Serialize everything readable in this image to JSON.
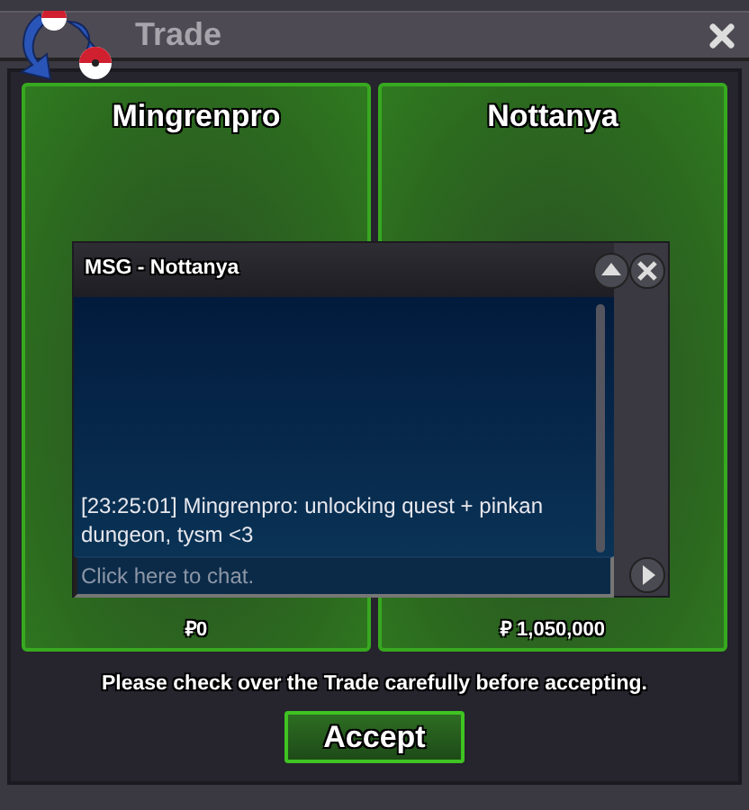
{
  "window": {
    "title": "Trade"
  },
  "traders": [
    {
      "name": "Mingrenpro",
      "money": "₽0"
    },
    {
      "name": "Nottanya",
      "money": "₽ 1,050,000"
    }
  ],
  "chat": {
    "title": "MSG - Nottanya",
    "messages": [
      "[23:25:01] Mingrenpro: unlocking quest + pinkan dungeon, tysm <3"
    ],
    "placeholder": "Click here to chat."
  },
  "notice": "Please check over the Trade carefully before accepting.",
  "accept_button": "Accept"
}
